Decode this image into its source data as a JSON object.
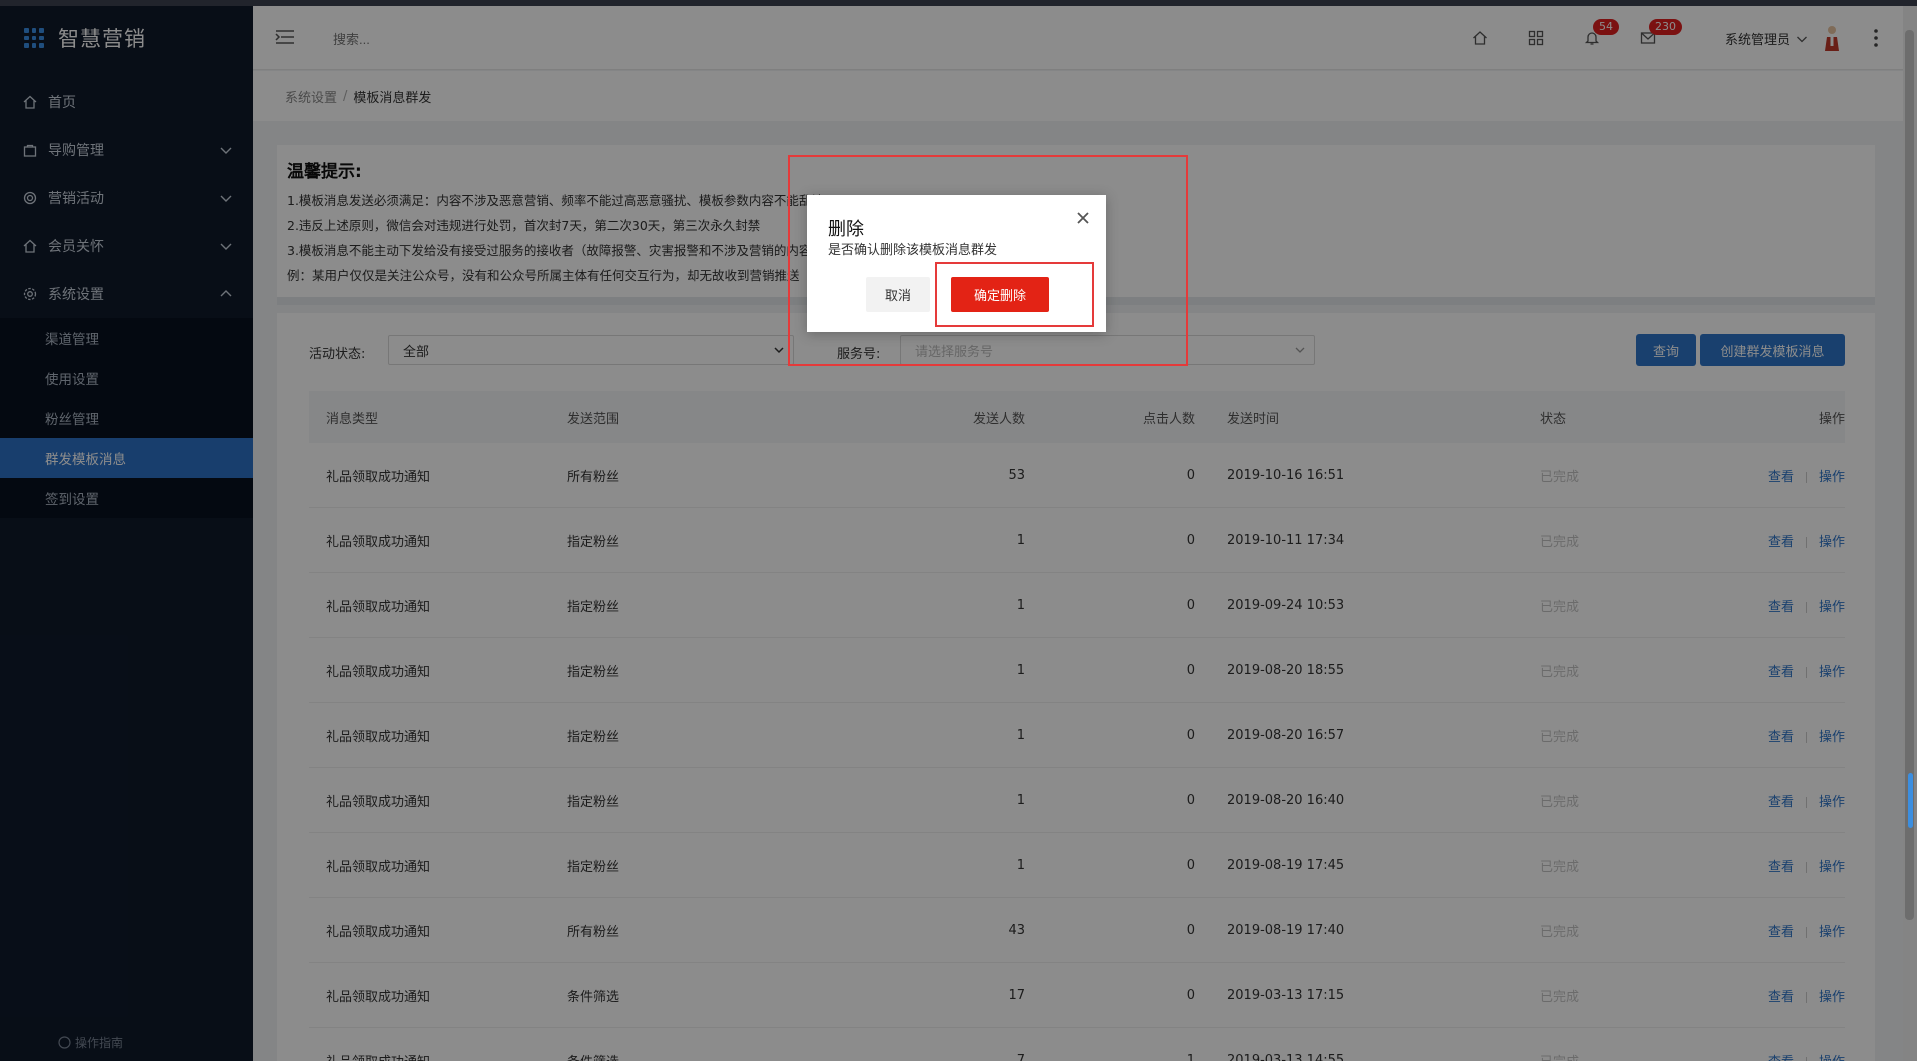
{
  "app": {
    "title": "智慧营销"
  },
  "sidebar": {
    "items": [
      {
        "label": "首页",
        "icon": "home-icon"
      },
      {
        "label": "导购管理",
        "icon": "bag-icon"
      },
      {
        "label": "营销活动",
        "icon": "target-icon"
      },
      {
        "label": "会员关怀",
        "icon": "home-icon"
      },
      {
        "label": "系统设置",
        "icon": "gear-icon"
      }
    ],
    "sub_items": [
      "渠道管理",
      "使用设置",
      "粉丝管理",
      "群发模板消息",
      "签到设置"
    ],
    "active_sub": "群发模板消息",
    "guide": "操作指南"
  },
  "header": {
    "search_placeholder": "搜索...",
    "notify_count": "54",
    "message_count": "230",
    "user_name": "系统管理员"
  },
  "breadcrumb": {
    "parent": "系统设置",
    "sep": "/",
    "current": "模板消息群发"
  },
  "tip": {
    "title": "温馨提示:",
    "lines": [
      "1.模板消息发送必须满足：内容不涉及恶意营销、频率不能过高恶意骚扰、模板参数内容不能乱填写",
      "2.违反上述原则，微信会对违规进行处罚，首次封7天，第二次30天，第三次永久封禁",
      "3.模板消息不能主动下发给没有接受过服务的接收者（故障报警、灾害报警和不涉及营销的内容除外）",
      "例：某用户仅仅是关注公众号，没有和公众号所属主体有任何交互行为，却无故收到营销推送"
    ]
  },
  "filter": {
    "status_label": "活动状态:",
    "status_value": "全部",
    "service_label": "服务号:",
    "service_placeholder": "请选择服务号",
    "query_button": "查询",
    "create_button": "创建群发模板消息"
  },
  "table": {
    "headers": [
      "消息类型",
      "发送范围",
      "发送人数",
      "点击人数",
      "发送时间",
      "状态",
      "操作"
    ],
    "rows": [
      {
        "type": "礼品领取成功通知",
        "scope": "所有粉丝",
        "sent": "53",
        "clicks": "0",
        "time": "2019-10-16 16:51",
        "status": "已完成"
      },
      {
        "type": "礼品领取成功通知",
        "scope": "指定粉丝",
        "sent": "1",
        "clicks": "0",
        "time": "2019-10-11 17:34",
        "status": "已完成"
      },
      {
        "type": "礼品领取成功通知",
        "scope": "指定粉丝",
        "sent": "1",
        "clicks": "0",
        "time": "2019-09-24 10:53",
        "status": "已完成"
      },
      {
        "type": "礼品领取成功通知",
        "scope": "指定粉丝",
        "sent": "1",
        "clicks": "0",
        "time": "2019-08-20 18:55",
        "status": "已完成"
      },
      {
        "type": "礼品领取成功通知",
        "scope": "指定粉丝",
        "sent": "1",
        "clicks": "0",
        "time": "2019-08-20 16:57",
        "status": "已完成"
      },
      {
        "type": "礼品领取成功通知",
        "scope": "指定粉丝",
        "sent": "1",
        "clicks": "0",
        "time": "2019-08-20 16:40",
        "status": "已完成"
      },
      {
        "type": "礼品领取成功通知",
        "scope": "指定粉丝",
        "sent": "1",
        "clicks": "0",
        "time": "2019-08-19 17:45",
        "status": "已完成"
      },
      {
        "type": "礼品领取成功通知",
        "scope": "所有粉丝",
        "sent": "43",
        "clicks": "0",
        "time": "2019-08-19 17:40",
        "status": "已完成"
      },
      {
        "type": "礼品领取成功通知",
        "scope": "条件筛选",
        "sent": "17",
        "clicks": "0",
        "time": "2019-03-13 17:15",
        "status": "已完成"
      },
      {
        "type": "礼品领取成功通知",
        "scope": "条件筛选",
        "sent": "7",
        "clicks": "1",
        "time": "2019-03-13 14:55",
        "status": "已完成"
      }
    ],
    "action_view": "查看",
    "action_op": "操作"
  },
  "modal": {
    "title": "删除",
    "message": "是否确认删除该模板消息群发",
    "cancel": "取消",
    "confirm": "确定删除"
  },
  "colors": {
    "primary": "#2f76c9",
    "danger": "#e32315",
    "sidebar_bg": "#0f1a2b",
    "highlight": "#e53a3a"
  }
}
